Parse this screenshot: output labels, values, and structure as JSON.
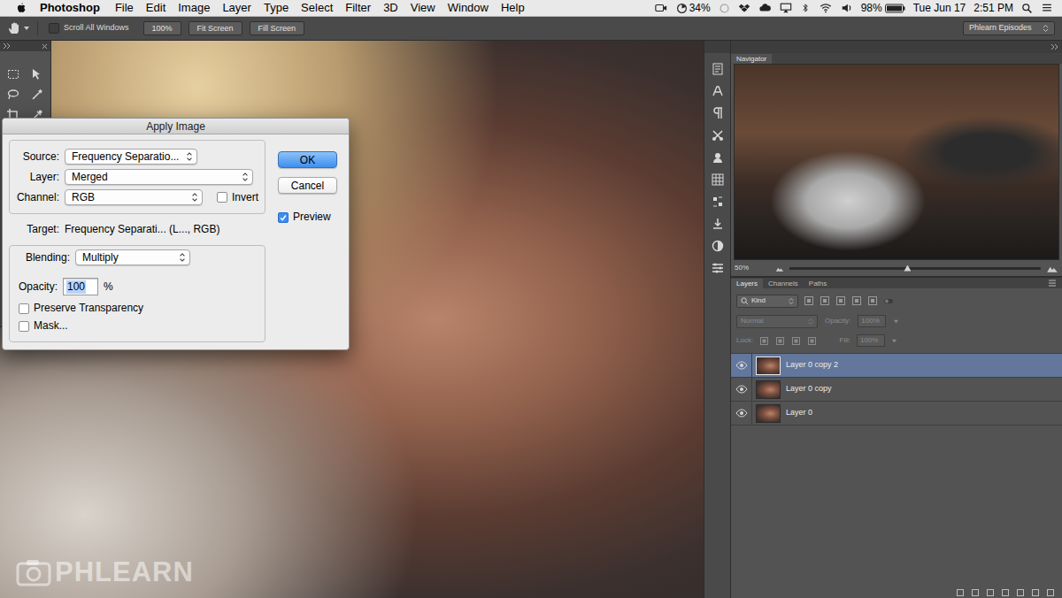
{
  "menubar": {
    "app": "Photoshop",
    "menus": [
      "File",
      "Edit",
      "Image",
      "Layer",
      "Type",
      "Select",
      "Filter",
      "3D",
      "View",
      "Window",
      "Help"
    ],
    "status": {
      "cpu": "34%",
      "battery": "98%",
      "date": "Tue Jun 17",
      "time": "2:51 PM"
    }
  },
  "options_bar": {
    "scroll_all_windows": {
      "label": "Scroll All Windows",
      "checked": false
    },
    "buttons": [
      "100%",
      "Fit Screen",
      "Fill Screen"
    ],
    "workspace": "Phlearn Episodes"
  },
  "toolbar": {
    "tools": [
      {
        "selected": false
      },
      {
        "selected": false
      },
      {
        "selected": false
      },
      {
        "selected": false
      },
      {
        "selected": false
      },
      {
        "selected": false
      },
      {
        "selected": false
      },
      {
        "selected": false
      },
      {
        "selected": false
      },
      {
        "selected": false
      },
      {
        "selected": false
      },
      {
        "selected": false
      },
      {
        "selected": false
      },
      {
        "selected": false
      },
      {
        "selected": false
      },
      {
        "selected": false
      },
      {
        "selected": false
      },
      {
        "selected": false
      },
      {
        "selected": true
      },
      {
        "selected": false
      }
    ]
  },
  "apply_image": {
    "title": "Apply Image",
    "source": {
      "label": "Source:",
      "value": "Frequency Separatio..."
    },
    "layer": {
      "label": "Layer:",
      "value": "Merged"
    },
    "channel": {
      "label": "Channel:",
      "value": "RGB"
    },
    "invert": {
      "label": "Invert",
      "checked": false
    },
    "target": {
      "label": "Target:",
      "value": "Frequency Separati... (L..., RGB)"
    },
    "blending": {
      "label": "Blending:",
      "value": "Multiply"
    },
    "opacity": {
      "label": "Opacity:",
      "value": "100",
      "unit": "%"
    },
    "preserve_transparency": {
      "label": "Preserve Transparency",
      "checked": false
    },
    "mask": {
      "label": "Mask...",
      "checked": false
    },
    "buttons": [
      {
        "label": "OK",
        "default": true
      },
      {
        "label": "Cancel",
        "default": false
      }
    ],
    "preview": {
      "label": "Preview",
      "checked": true
    }
  },
  "navigator": {
    "title": "Navigator",
    "zoom": "50%",
    "zoom_level": 0.47
  },
  "layers_panel": {
    "tabs": [
      {
        "label": "Layers",
        "selected": true
      },
      {
        "label": "Channels",
        "selected": false
      },
      {
        "label": "Paths",
        "selected": false
      }
    ],
    "filter": "Kind",
    "blend_mode": "Normal",
    "opacity_label": "Opacity:",
    "opacity": "100%",
    "lock_label": "Lock:",
    "fill_label": "Fill:",
    "fill": "100%",
    "disabled": true,
    "layers": [
      {
        "name": "Layer 0 copy 2",
        "visible": true,
        "selected": true
      },
      {
        "name": "Layer 0 copy",
        "visible": true,
        "selected": false
      },
      {
        "name": "Layer 0",
        "visible": true,
        "selected": false
      }
    ]
  },
  "watermark": "PHLEARN"
}
